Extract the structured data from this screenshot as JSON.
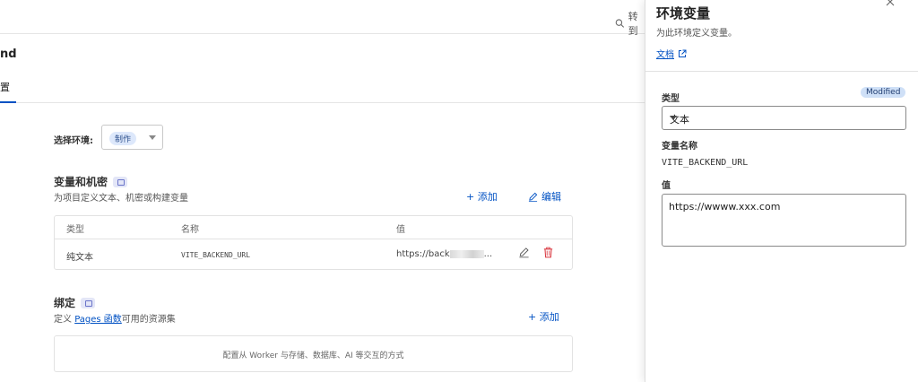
{
  "header": {
    "search_label": "转到"
  },
  "project": {
    "title_partial": "nd"
  },
  "tabs": [
    {
      "label": "置"
    }
  ],
  "environment": {
    "label": "选择环境:",
    "selected": "制作"
  },
  "variables": {
    "title": "变量和机密",
    "subtitle": "为项目定义文本、机密或构建变量",
    "add_label": "+ 添加",
    "edit_label": "编辑",
    "columns": [
      "类型",
      "名称",
      "值"
    ],
    "rows": [
      {
        "type": "纯文本",
        "name": "VITE_BACKEND_URL",
        "value_prefix": "https://back",
        "value_suffix": "..."
      }
    ]
  },
  "bindings": {
    "title": "绑定",
    "subtitle_prefix": "定义 ",
    "subtitle_link": "Pages 函数",
    "subtitle_suffix": "可用的资源集",
    "add_label": "+ 添加",
    "empty_text": "配置从 Worker 与存储、数据库、AI 等交互的方式"
  },
  "panel": {
    "title": "环境变量",
    "subtitle": "为此环境定义变量。",
    "docs_link": "文档",
    "type_label": "类型",
    "modified_badge": "Modified",
    "type_value": "文本",
    "name_label": "变量名称",
    "name_value": "VITE_BACKEND_URL",
    "value_label": "值",
    "value_text": "https://wwww.xxx.com"
  },
  "colors": {
    "accent": "#0051c3",
    "delete": "#d9363e",
    "badge_bg": "#cfe0f7"
  }
}
